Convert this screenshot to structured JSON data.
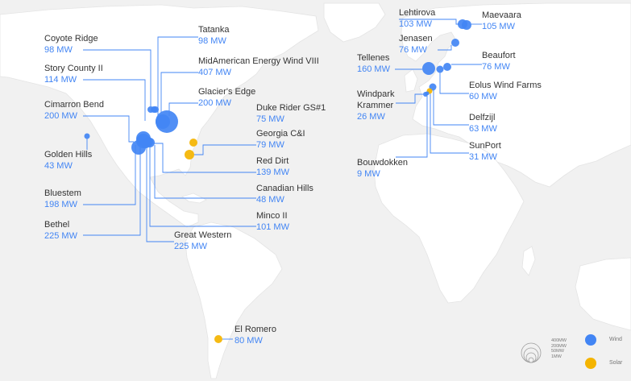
{
  "colors": {
    "wind": "#4285f4",
    "solar": "#f4b400",
    "land": "#ffffff",
    "water": "#f1f1f1",
    "leader": "#4285f4"
  },
  "projects": [
    {
      "id": "coyote-ridge",
      "name": "Coyote Ridge",
      "capacity": "98 MW",
      "type": "wind"
    },
    {
      "id": "story-county-ii",
      "name": "Story County II",
      "capacity": "114 MW",
      "type": "wind"
    },
    {
      "id": "cimarron-bend",
      "name": "Cimarron Bend",
      "capacity": "200 MW",
      "type": "wind"
    },
    {
      "id": "golden-hills",
      "name": "Golden Hills",
      "capacity": "43 MW",
      "type": "wind"
    },
    {
      "id": "bluestem",
      "name": "Bluestem",
      "capacity": "198 MW",
      "type": "wind"
    },
    {
      "id": "bethel",
      "name": "Bethel",
      "capacity": "225 MW",
      "type": "wind"
    },
    {
      "id": "tatanka",
      "name": "Tatanka",
      "capacity": "98 MW",
      "type": "wind"
    },
    {
      "id": "midamerican",
      "name": "MidAmerican Energy Wind VIII",
      "capacity": "407 MW",
      "type": "wind"
    },
    {
      "id": "glaciers-edge",
      "name": "Glacier's Edge",
      "capacity": "200 MW",
      "type": "wind"
    },
    {
      "id": "duke-rider",
      "name": "Duke Rider GS#1",
      "capacity": "75 MW",
      "type": "solar"
    },
    {
      "id": "georgia-ci",
      "name": "Georgia C&I",
      "capacity": "79 MW",
      "type": "solar"
    },
    {
      "id": "red-dirt",
      "name": "Red Dirt",
      "capacity": "139 MW",
      "type": "wind"
    },
    {
      "id": "canadian-hills",
      "name": "Canadian Hills",
      "capacity": "48 MW",
      "type": "wind"
    },
    {
      "id": "minco-ii",
      "name": "Minco II",
      "capacity": "101 MW",
      "type": "wind"
    },
    {
      "id": "great-western",
      "name": "Great Western",
      "capacity": "225 MW",
      "type": "wind"
    },
    {
      "id": "el-romero",
      "name": "El Romero",
      "capacity": "80 MW",
      "type": "solar"
    },
    {
      "id": "lehtirova",
      "name": "Lehtirova",
      "capacity": "103 MW",
      "type": "wind"
    },
    {
      "id": "maevaara",
      "name": "Maevaara",
      "capacity": "105 MW",
      "type": "wind"
    },
    {
      "id": "jenasen",
      "name": "Jenasen",
      "capacity": "76 MW",
      "type": "wind"
    },
    {
      "id": "tellenes",
      "name": "Tellenes",
      "capacity": "160 MW",
      "type": "wind"
    },
    {
      "id": "beaufort",
      "name": "Beaufort",
      "capacity": "76 MW",
      "type": "wind"
    },
    {
      "id": "eolus",
      "name": "Eolus Wind Farms",
      "capacity": "60 MW",
      "type": "wind"
    },
    {
      "id": "windpark-krammer",
      "name": "Windpark\nKrammer",
      "capacity": "26 MW",
      "type": "wind"
    },
    {
      "id": "delfzijl",
      "name": "Delfzijl",
      "capacity": "63 MW",
      "type": "wind"
    },
    {
      "id": "sunport",
      "name": "SunPort",
      "capacity": "31 MW",
      "type": "solar"
    },
    {
      "id": "bouwdokken",
      "name": "Bouwdokken",
      "capacity": "9 MW",
      "type": "wind"
    }
  ],
  "legend": {
    "sizes": [
      "400MW",
      "200MW",
      "50MW",
      "1MW"
    ],
    "wind_label": "Wind",
    "solar_label": "Solar"
  }
}
